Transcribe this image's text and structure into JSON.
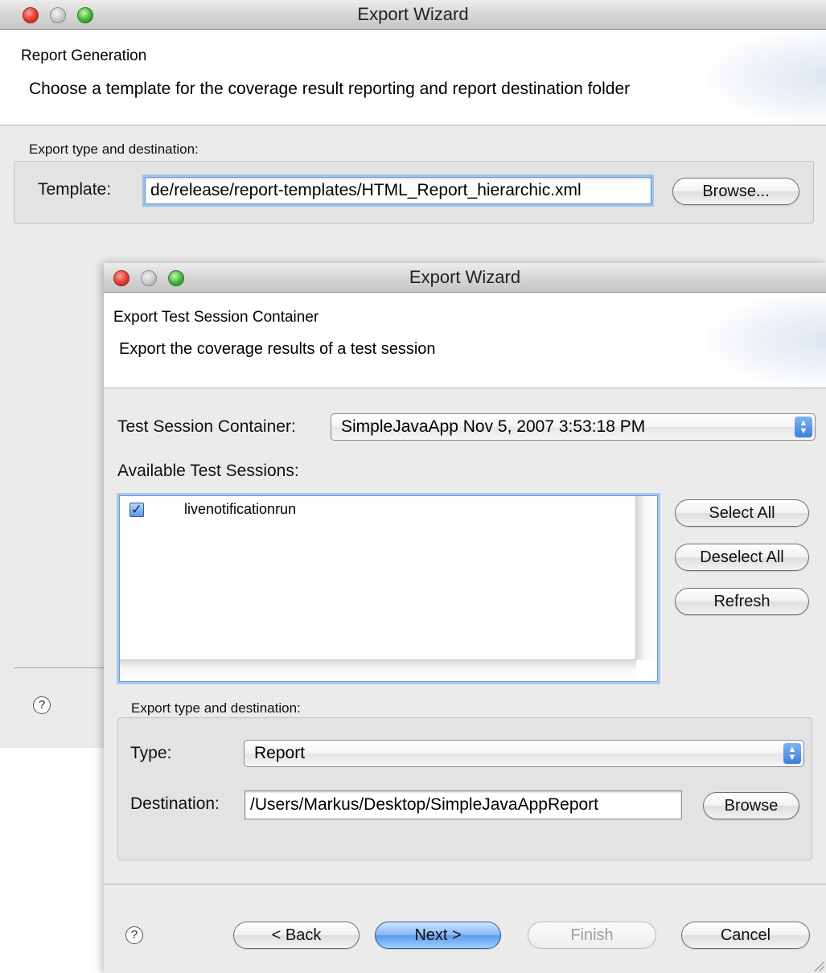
{
  "back_window": {
    "title": "Export Wizard",
    "header_title": "Report Generation",
    "header_description": "Choose a template for the coverage result reporting and report destination folder",
    "group_label": "Export type and destination:",
    "template_label": "Template:",
    "template_value": "de/release/report-templates/HTML_Report_hierarchic.xml",
    "browse_label": "Browse...",
    "help_icon": "?"
  },
  "front_window": {
    "title": "Export Wizard",
    "header_title": "Export Test Session Container",
    "header_description": "Export the coverage results of a test session",
    "container_label": "Test Session Container:",
    "container_value": "SimpleJavaApp Nov 5, 2007 3:53:18 PM",
    "available_label": "Available Test Sessions:",
    "sessions": [
      {
        "label": "livenotificationrun",
        "checked": true
      }
    ],
    "select_all_label": "Select All",
    "deselect_all_label": "Deselect All",
    "refresh_label": "Refresh",
    "export_group_label": "Export type and destination:",
    "type_label": "Type:",
    "type_value": "Report",
    "destination_label": "Destination:",
    "destination_value": "/Users/Markus/Desktop/SimpleJavaAppReport",
    "browse_label": "Browse",
    "help_icon": "?",
    "back_label": "< Back",
    "next_label": "Next >",
    "finish_label": "Finish",
    "cancel_label": "Cancel"
  },
  "colors": {
    "accent": "#5d9aeb",
    "focus_ring": "#9cc2ee",
    "dialog_body": "#ebebeb"
  }
}
